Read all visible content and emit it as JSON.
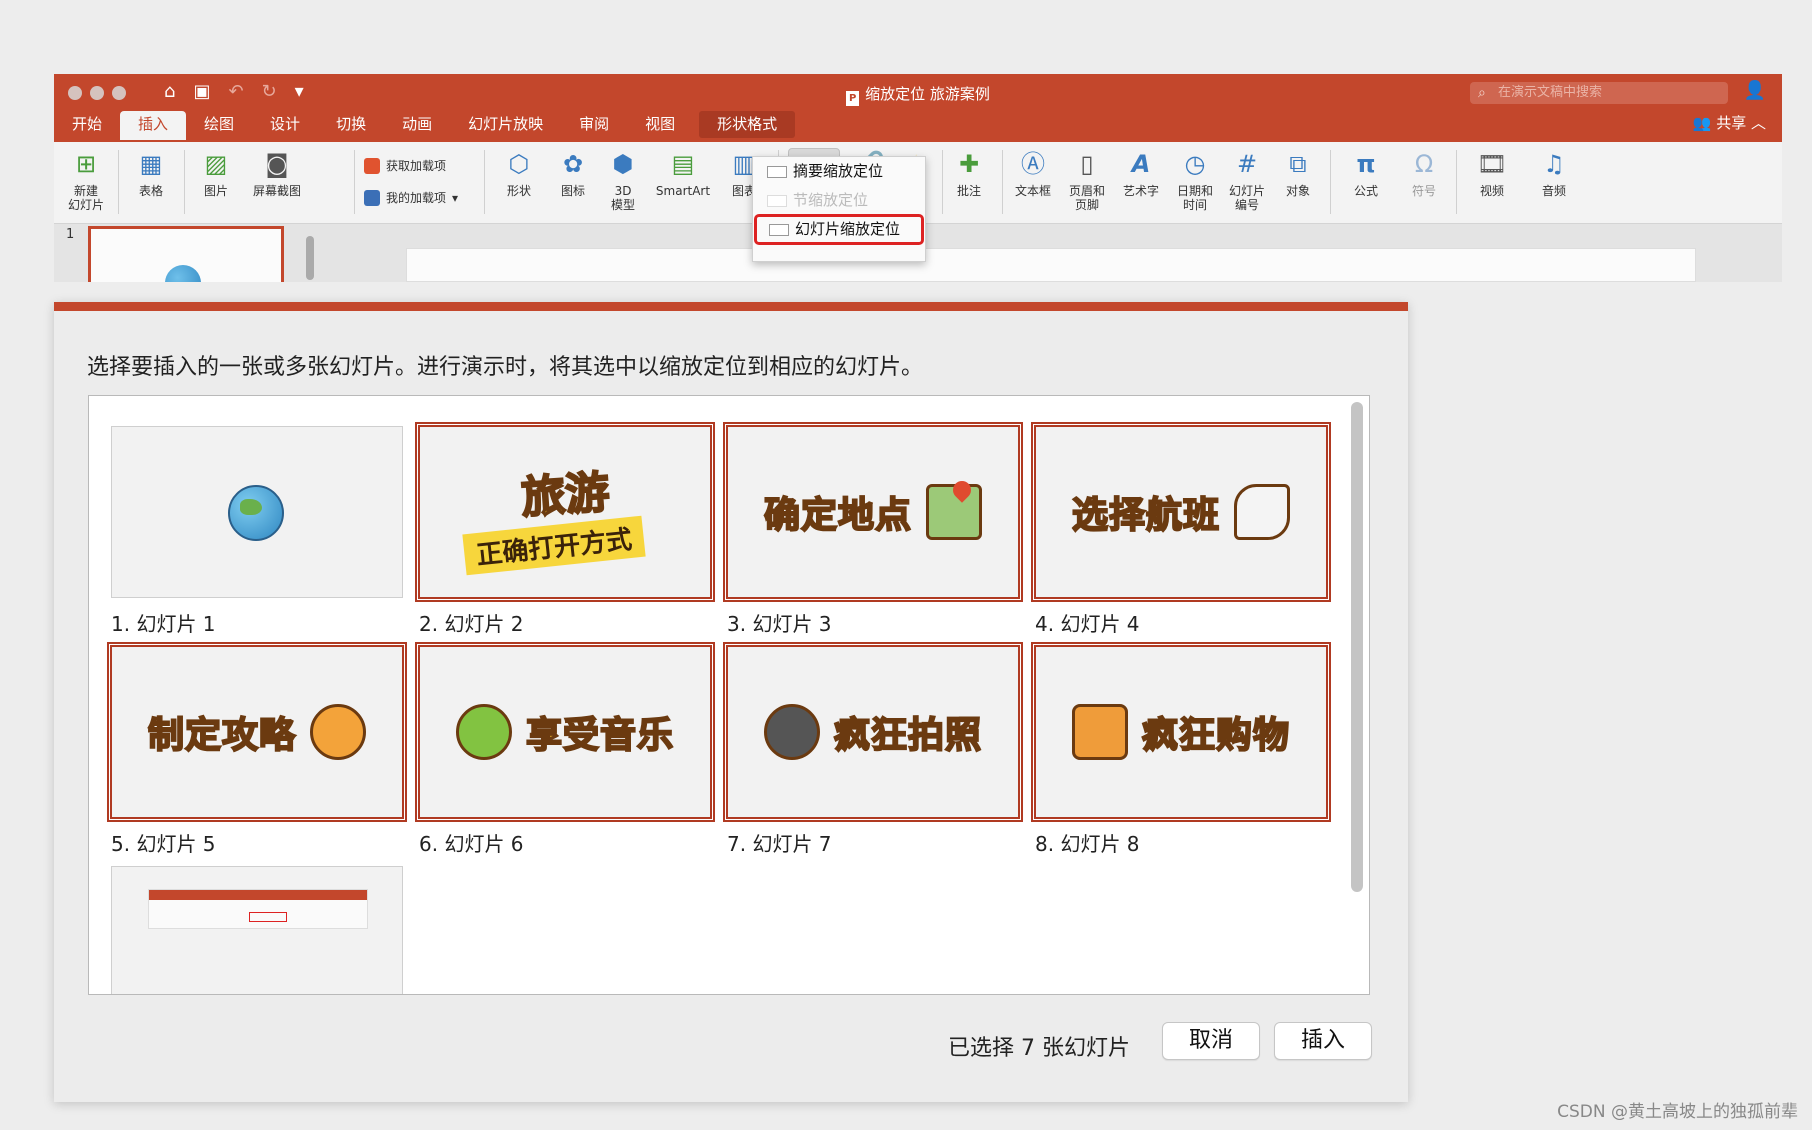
{
  "window": {
    "title": "缩放定位 旅游案例",
    "search_placeholder": "在演示文稿中搜索",
    "share_label": "共享",
    "tabs": [
      {
        "label": "开始"
      },
      {
        "label": "插入"
      },
      {
        "label": "绘图"
      },
      {
        "label": "设计"
      },
      {
        "label": "切换"
      },
      {
        "label": "动画"
      },
      {
        "label": "幻灯片放映"
      },
      {
        "label": "审阅"
      },
      {
        "label": "视图"
      },
      {
        "label": "形状格式"
      }
    ],
    "active_tab": "插入"
  },
  "ribbon": {
    "new_slide": "新建\n幻灯片",
    "table": "表格",
    "picture": "图片",
    "screenshot": "屏幕截图",
    "get_addins": "获取加载项",
    "my_addins": "我的加载项",
    "shapes": "形状",
    "icons": "图标",
    "model_3d": "3D\n模型",
    "smartart": "SmartArt",
    "chart": "图表",
    "comment": "批注",
    "textbox": "文本框",
    "header_footer": "页眉和\n页脚",
    "wordart": "艺术字",
    "datetime": "日期和\n时间",
    "slide_number": "幻灯片\n编号",
    "object": "对象",
    "equation": "公式",
    "symbol": "符号",
    "video": "视频",
    "audio": "音频"
  },
  "zoom_menu": {
    "items": [
      {
        "label": "摘要缩放定位",
        "enabled": true
      },
      {
        "label": "节缩放定位",
        "enabled": false
      },
      {
        "label": "幻灯片缩放定位",
        "enabled": true,
        "highlighted": true
      }
    ]
  },
  "thumbnail_strip": {
    "slide_number": "1"
  },
  "dialog": {
    "instruction": "选择要插入的一张或多张幻灯片。进行演示时，将其选中以缩放定位到相应的幻灯片。",
    "slides": [
      {
        "label": "1. 幻灯片 1",
        "selected": false,
        "art": "globe"
      },
      {
        "label": "2. 幻灯片 2",
        "selected": true,
        "art_title": "旅游",
        "art_sub": "正确打开方式"
      },
      {
        "label": "3. 幻灯片 3",
        "selected": true,
        "art_text": "确定地点",
        "icon": "map-pin-icon"
      },
      {
        "label": "4. 幻灯片 4",
        "selected": true,
        "art_text": "选择航班",
        "icon": "airplane-icon"
      },
      {
        "label": "5. 幻灯片 5",
        "selected": true,
        "art_text": "制定攻略",
        "icon": "chick-travel-icon"
      },
      {
        "label": "6. 幻灯片 6",
        "selected": true,
        "art_text": "享受音乐",
        "icon": "guitar-icon"
      },
      {
        "label": "7. 幻灯片 7",
        "selected": true,
        "art_text": "疯狂拍照",
        "icon": "camera-icon"
      },
      {
        "label": "8. 幻灯片 8",
        "selected": true,
        "art_text": "疯狂购物",
        "icon": "shopping-bag-icon"
      },
      {
        "label": "",
        "selected": false,
        "art": "screenshot-preview"
      }
    ],
    "selection_status": "已选择 7 张幻灯片",
    "cancel_label": "取消",
    "insert_label": "插入"
  },
  "watermark": "CSDN @黄土高坡上的独孤前辈",
  "colors": {
    "accent": "#c3472c",
    "selection_border": "#b03a22",
    "art_yellow": "#f7c12b"
  }
}
